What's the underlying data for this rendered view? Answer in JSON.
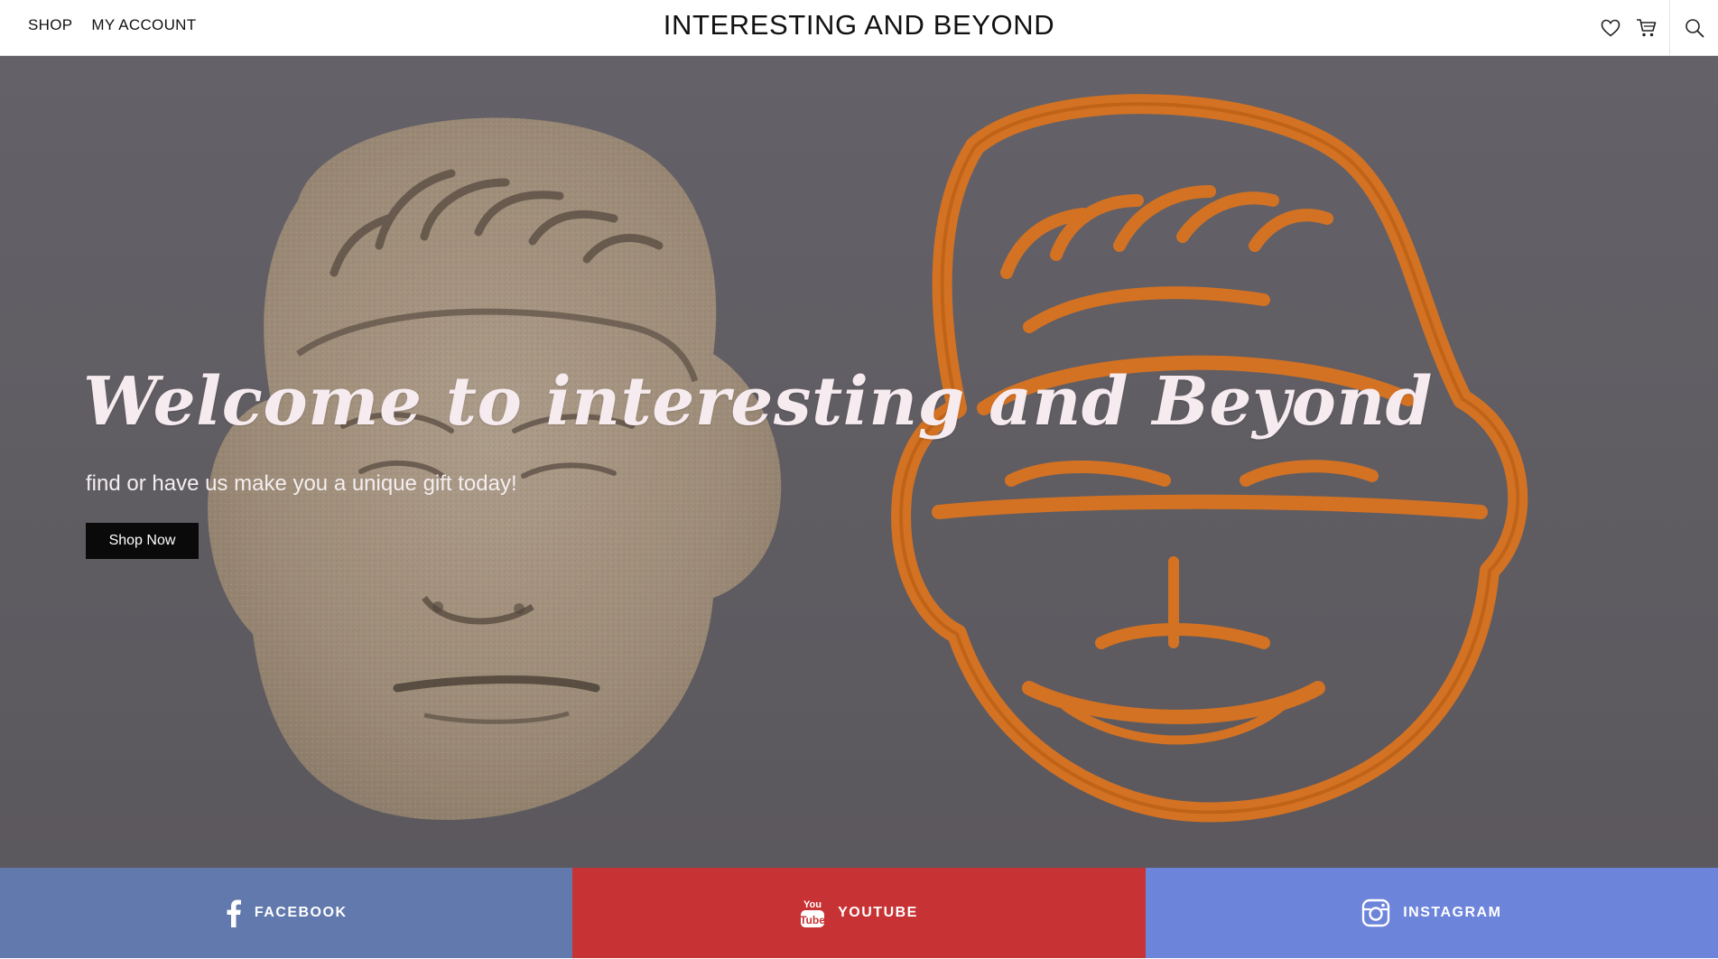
{
  "header": {
    "nav": [
      {
        "label": "SHOP"
      },
      {
        "label": "MY ACCOUNT"
      }
    ],
    "site_title": "INTERESTING AND BEYOND",
    "icons": [
      "heart-icon",
      "cart-icon",
      "search-icon"
    ]
  },
  "hero": {
    "heading": "Welcome to interesting and Beyond",
    "subheading": "find or have us make you a unique gift today!",
    "cta_label": "Shop Now",
    "background_image": "photo of a sand-colored face imprint beside an orange 3D-printed face cookie cutter"
  },
  "social": [
    {
      "label": "FACEBOOK",
      "icon": "facebook-icon",
      "color": "#6279ad"
    },
    {
      "label": "YOUTUBE",
      "icon": "youtube-icon",
      "color": "#c73234"
    },
    {
      "label": "INSTAGRAM",
      "icon": "instagram-icon",
      "color": "#6d84db"
    }
  ],
  "colors": {
    "hero_text": "#f6ebee",
    "button_bg": "#0a0a0a",
    "cutter_orange": "#f07f22",
    "sand": "#b8a48c"
  }
}
